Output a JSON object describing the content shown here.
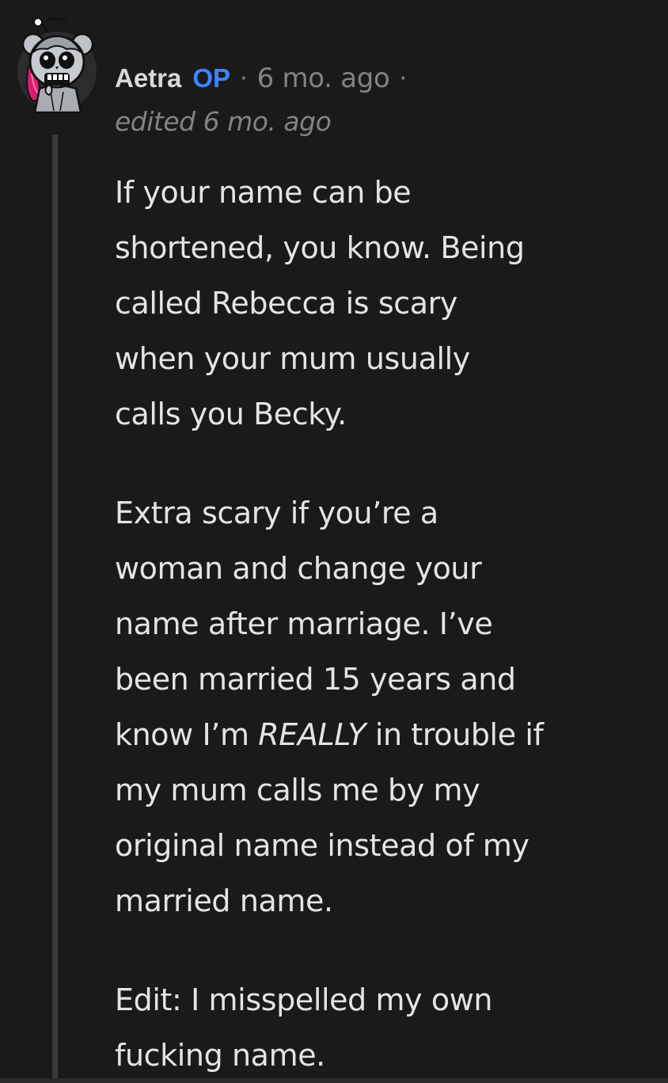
{
  "comment": {
    "author": "Aetra",
    "op_badge": "OP",
    "separator": "·",
    "timestamp": "6 mo. ago",
    "edited": "edited 6 mo. ago",
    "paragraph1_lines": [
      "If your name can be",
      "shortened, you know. Being",
      "called Rebecca is scary",
      "when your mum usually",
      "calls you Becky."
    ],
    "paragraph2": {
      "line1": "Extra scary if you’re a",
      "line2": "woman and change your",
      "line3": "name after marriage. I’ve",
      "line4": "been married 15 years and",
      "line5_before": "know I’m ",
      "line5_emphasis": "REALLY",
      "line5_after": " in trouble if",
      "line6": "my mum calls me by my",
      "line7": "original name instead of my",
      "line8": "married name."
    },
    "paragraph3_lines": [
      "Edit: I misspelled my own",
      "fucking name."
    ]
  },
  "colors": {
    "background": "#1a1a1b",
    "op_badge": "#3d84ff",
    "meta": "#818384",
    "text": "#e4e4e4",
    "thread_line": "#3a3a3c"
  },
  "icons": {
    "avatar": "snoo-avatar-skull-icon"
  }
}
